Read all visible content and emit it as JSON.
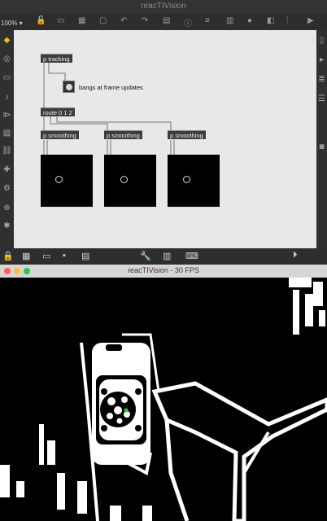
{
  "max_window": {
    "title": "reacTIVision",
    "zoom": "100%",
    "toolbar_icons": [
      "lock-icon",
      "presentation-icon",
      "grid-icon",
      "new-object-icon",
      "undo-icon",
      "redo-icon",
      "patcher-icon",
      "inspector-icon",
      "code-icon",
      "layout-icon",
      "record-icon",
      "bpatcher-icon",
      "play-icon",
      "mixer-icon"
    ],
    "left_sidebar_icons": [
      "cube-icon",
      "target-icon",
      "browser-icon",
      "music-icon",
      "sound-icon",
      "image-icon",
      "link-icon",
      "puzzle-icon",
      "gear-icon",
      "star-icon"
    ],
    "right_sidebar_icons": [
      "panel-icon",
      "cursor-icon",
      "grid-icon",
      "hand-icon",
      "camera-icon"
    ],
    "bottom_icons": [
      "lock-icon",
      "grid-icon",
      "presentation-icon",
      "wrench-icon",
      "keyboard-icon",
      "midi-icon",
      "play-icon"
    ]
  },
  "patch": {
    "p_tracking": "p tracking",
    "bang_comment": "bangs at frame updates",
    "route": "route 0 1 2",
    "smoothing_1": "p smoothing",
    "smoothing_2": "p smoothing",
    "smoothing_3": "p smoothing"
  },
  "tracking_window": {
    "title": "reacTIVision - 30 FPS",
    "traffic_light_colors": [
      "#ff5f57",
      "#febc2e",
      "#28c840"
    ]
  }
}
